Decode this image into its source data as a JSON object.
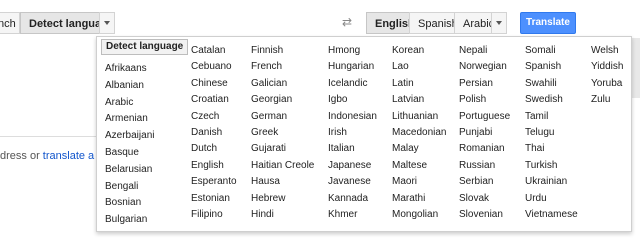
{
  "toolbar": {
    "source_tabs": [
      "nch",
      "Detect language"
    ],
    "target_tabs": [
      "English",
      "Spanish",
      "Arabic"
    ],
    "translate_label": "Translate",
    "swap_icon": "swap-icon"
  },
  "left_hint": {
    "prefix": "dress or ",
    "link": "translate a doc"
  },
  "dropdown": {
    "detect_label": "Detect language",
    "columns": [
      [
        "Afrikaans",
        "Albanian",
        "Arabic",
        "Armenian",
        "Azerbaijani",
        "Basque",
        "Belarusian",
        "Bengali",
        "Bosnian",
        "Bulgarian"
      ],
      [
        "Catalan",
        "Cebuano",
        "Chinese",
        "Croatian",
        "Czech",
        "Danish",
        "Dutch",
        "English",
        "Esperanto",
        "Estonian",
        "Filipino"
      ],
      [
        "Finnish",
        "French",
        "Galician",
        "Georgian",
        "German",
        "Greek",
        "Gujarati",
        "Haitian Creole",
        "Hausa",
        "Hebrew",
        "Hindi"
      ],
      [
        "Hmong",
        "Hungarian",
        "Icelandic",
        "Igbo",
        "Indonesian",
        "Irish",
        "Italian",
        "Japanese",
        "Javanese",
        "Kannada",
        "Khmer"
      ],
      [
        "Korean",
        "Lao",
        "Latin",
        "Latvian",
        "Lithuanian",
        "Macedonian",
        "Malay",
        "Maltese",
        "Maori",
        "Marathi",
        "Mongolian"
      ],
      [
        "Nepali",
        "Norwegian",
        "Persian",
        "Polish",
        "Portuguese",
        "Punjabi",
        "Romanian",
        "Russian",
        "Serbian",
        "Slovak",
        "Slovenian"
      ],
      [
        "Somali",
        "Spanish",
        "Swahili",
        "Swedish",
        "Tamil",
        "Telugu",
        "Thai",
        "Turkish",
        "Ukrainian",
        "Urdu",
        "Vietnamese"
      ],
      [
        "Welsh",
        "Yiddish",
        "Yoruba",
        "Zulu"
      ]
    ]
  },
  "colors": {
    "translate_bg": "#4d90fe",
    "link": "#1155cc"
  }
}
